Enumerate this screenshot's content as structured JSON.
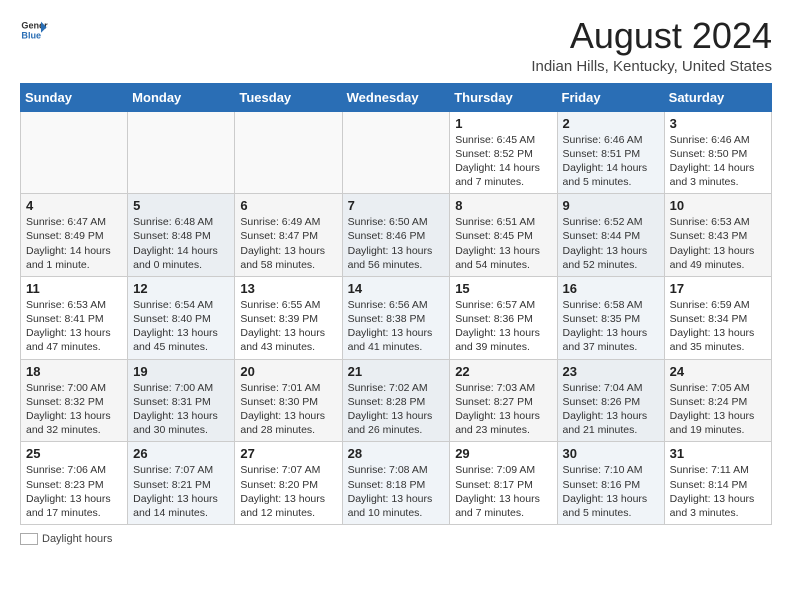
{
  "header": {
    "logo_general": "General",
    "logo_blue": "Blue",
    "main_title": "August 2024",
    "sub_title": "Indian Hills, Kentucky, United States"
  },
  "calendar": {
    "days_of_week": [
      "Sunday",
      "Monday",
      "Tuesday",
      "Wednesday",
      "Thursday",
      "Friday",
      "Saturday"
    ],
    "weeks": [
      [
        {
          "day": "",
          "info": ""
        },
        {
          "day": "",
          "info": ""
        },
        {
          "day": "",
          "info": ""
        },
        {
          "day": "",
          "info": ""
        },
        {
          "day": "1",
          "info": "Sunrise: 6:45 AM\nSunset: 8:52 PM\nDaylight: 14 hours and 7 minutes."
        },
        {
          "day": "2",
          "info": "Sunrise: 6:46 AM\nSunset: 8:51 PM\nDaylight: 14 hours and 5 minutes."
        },
        {
          "day": "3",
          "info": "Sunrise: 6:46 AM\nSunset: 8:50 PM\nDaylight: 14 hours and 3 minutes."
        }
      ],
      [
        {
          "day": "4",
          "info": "Sunrise: 6:47 AM\nSunset: 8:49 PM\nDaylight: 14 hours and 1 minute."
        },
        {
          "day": "5",
          "info": "Sunrise: 6:48 AM\nSunset: 8:48 PM\nDaylight: 14 hours and 0 minutes."
        },
        {
          "day": "6",
          "info": "Sunrise: 6:49 AM\nSunset: 8:47 PM\nDaylight: 13 hours and 58 minutes."
        },
        {
          "day": "7",
          "info": "Sunrise: 6:50 AM\nSunset: 8:46 PM\nDaylight: 13 hours and 56 minutes."
        },
        {
          "day": "8",
          "info": "Sunrise: 6:51 AM\nSunset: 8:45 PM\nDaylight: 13 hours and 54 minutes."
        },
        {
          "day": "9",
          "info": "Sunrise: 6:52 AM\nSunset: 8:44 PM\nDaylight: 13 hours and 52 minutes."
        },
        {
          "day": "10",
          "info": "Sunrise: 6:53 AM\nSunset: 8:43 PM\nDaylight: 13 hours and 49 minutes."
        }
      ],
      [
        {
          "day": "11",
          "info": "Sunrise: 6:53 AM\nSunset: 8:41 PM\nDaylight: 13 hours and 47 minutes."
        },
        {
          "day": "12",
          "info": "Sunrise: 6:54 AM\nSunset: 8:40 PM\nDaylight: 13 hours and 45 minutes."
        },
        {
          "day": "13",
          "info": "Sunrise: 6:55 AM\nSunset: 8:39 PM\nDaylight: 13 hours and 43 minutes."
        },
        {
          "day": "14",
          "info": "Sunrise: 6:56 AM\nSunset: 8:38 PM\nDaylight: 13 hours and 41 minutes."
        },
        {
          "day": "15",
          "info": "Sunrise: 6:57 AM\nSunset: 8:36 PM\nDaylight: 13 hours and 39 minutes."
        },
        {
          "day": "16",
          "info": "Sunrise: 6:58 AM\nSunset: 8:35 PM\nDaylight: 13 hours and 37 minutes."
        },
        {
          "day": "17",
          "info": "Sunrise: 6:59 AM\nSunset: 8:34 PM\nDaylight: 13 hours and 35 minutes."
        }
      ],
      [
        {
          "day": "18",
          "info": "Sunrise: 7:00 AM\nSunset: 8:32 PM\nDaylight: 13 hours and 32 minutes."
        },
        {
          "day": "19",
          "info": "Sunrise: 7:00 AM\nSunset: 8:31 PM\nDaylight: 13 hours and 30 minutes."
        },
        {
          "day": "20",
          "info": "Sunrise: 7:01 AM\nSunset: 8:30 PM\nDaylight: 13 hours and 28 minutes."
        },
        {
          "day": "21",
          "info": "Sunrise: 7:02 AM\nSunset: 8:28 PM\nDaylight: 13 hours and 26 minutes."
        },
        {
          "day": "22",
          "info": "Sunrise: 7:03 AM\nSunset: 8:27 PM\nDaylight: 13 hours and 23 minutes."
        },
        {
          "day": "23",
          "info": "Sunrise: 7:04 AM\nSunset: 8:26 PM\nDaylight: 13 hours and 21 minutes."
        },
        {
          "day": "24",
          "info": "Sunrise: 7:05 AM\nSunset: 8:24 PM\nDaylight: 13 hours and 19 minutes."
        }
      ],
      [
        {
          "day": "25",
          "info": "Sunrise: 7:06 AM\nSunset: 8:23 PM\nDaylight: 13 hours and 17 minutes."
        },
        {
          "day": "26",
          "info": "Sunrise: 7:07 AM\nSunset: 8:21 PM\nDaylight: 13 hours and 14 minutes."
        },
        {
          "day": "27",
          "info": "Sunrise: 7:07 AM\nSunset: 8:20 PM\nDaylight: 13 hours and 12 minutes."
        },
        {
          "day": "28",
          "info": "Sunrise: 7:08 AM\nSunset: 8:18 PM\nDaylight: 13 hours and 10 minutes."
        },
        {
          "day": "29",
          "info": "Sunrise: 7:09 AM\nSunset: 8:17 PM\nDaylight: 13 hours and 7 minutes."
        },
        {
          "day": "30",
          "info": "Sunrise: 7:10 AM\nSunset: 8:16 PM\nDaylight: 13 hours and 5 minutes."
        },
        {
          "day": "31",
          "info": "Sunrise: 7:11 AM\nSunset: 8:14 PM\nDaylight: 13 hours and 3 minutes."
        }
      ]
    ]
  },
  "legend": {
    "daylight_label": "Daylight hours"
  }
}
